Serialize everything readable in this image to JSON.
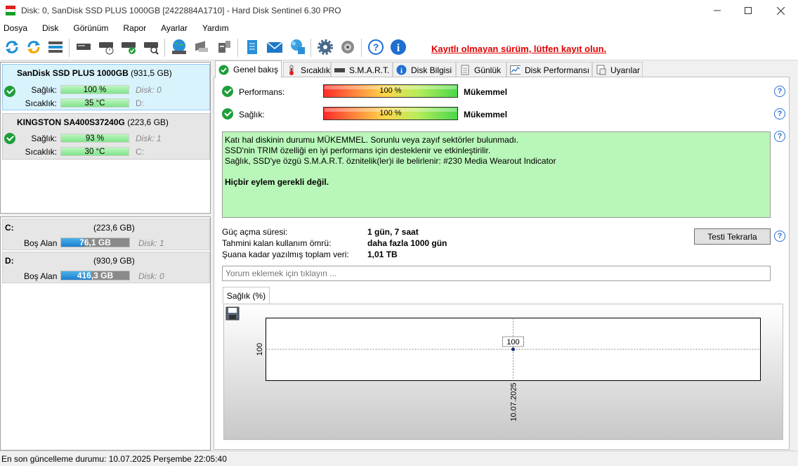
{
  "window": {
    "title": "Disk: 0, SanDisk SSD PLUS 1000GB [2422884A1710]  -  Hard Disk Sentinel 6.30 PRO"
  },
  "menu": [
    "Dosya",
    "Disk",
    "Görünüm",
    "Rapor",
    "Ayarlar",
    "Yardım"
  ],
  "toolbar": {
    "register_link": "Kayıtlı olmayan sürüm, lütfen kayıt olun.",
    "icons": [
      "refresh-icon",
      "refresh-all-icon",
      "disk-list-icon",
      "disk-info-icon",
      "disk-schedule-icon",
      "disk-check-icon",
      "disk-search-icon",
      "network-icon",
      "disk-surface-icon",
      "disk-backup-icon",
      "report-icon",
      "email-icon",
      "send-report-icon",
      "settings-icon",
      "sound-icon",
      "help-icon",
      "info-icon"
    ]
  },
  "disks": [
    {
      "name": "SanDisk SSD PLUS 1000GB",
      "size": "(931,5 GB)",
      "health_label": "Sağlık:",
      "health": "100 %",
      "health_frac": 1.0,
      "disk_no": "Disk: 0",
      "temp_label": "Sıcaklık:",
      "temp": "35 °C",
      "drive": "D:"
    },
    {
      "name": "KINGSTON SA400S37240G",
      "size": "(223,6 GB)",
      "health_label": "Sağlık:",
      "health": "93 %",
      "health_frac": 0.93,
      "disk_no": "Disk: 1",
      "temp_label": "Sıcaklık:",
      "temp": "30 °C",
      "drive": "C:"
    }
  ],
  "volumes": [
    {
      "letter": "C:",
      "size": "(223,6 GB)",
      "free_label": "Boş Alan",
      "free": "76,1 GB",
      "free_frac": 0.34,
      "disk": "Disk: 1"
    },
    {
      "letter": "D:",
      "size": "(930,9 GB)",
      "free_label": "Boş Alan",
      "free": "416,3 GB",
      "free_frac": 0.447,
      "disk": "Disk: 0"
    }
  ],
  "tabs": [
    "Genel bakış",
    "Sıcaklık",
    "S.M.A.R.T.",
    "Disk Bilgisi",
    "Günlük",
    "Disk Performansı",
    "Uyarılar"
  ],
  "overview": {
    "performance_label": "Performans:",
    "performance_value": "100 %",
    "performance_rating": "Mükemmel",
    "health_label": "Sağlık:",
    "health_value": "100 %",
    "health_rating": "Mükemmel",
    "status_lines": [
      "Katı hal diskinin durumu MÜKEMMEL. Sorunlu veya zayıf sektörler bulunmadı.",
      "SSD'nin TRIM özelliği en iyi performans için desteklenir ve etkinleştirilir.",
      "Sağlık, SSD'ye özgü S.M.A.R.T. öznitelik(ler)i ile belirlenir:  #230 Media Wearout Indicator"
    ],
    "status_action": "Hiçbir eylem gerekli değil.",
    "power_on_label": "Güç açma süresi:",
    "power_on_value": "1 gün, 7 saat",
    "lifetime_label": "Tahmini kalan kullanım ömrü:",
    "lifetime_value": "daha fazla 1000 gün",
    "written_label": "Şuana kadar yazılmış toplam veri:",
    "written_value": "1,01 TB",
    "retest_button": "Testi Tekrarla",
    "comment_placeholder": "Yorum eklemek için tıklayın ..."
  },
  "chart_tab": "Sağlık (%)",
  "chart_data": {
    "type": "line",
    "x": [
      "10.07.2025"
    ],
    "series": [
      {
        "values": [
          100
        ]
      }
    ],
    "data_labels": [
      "100"
    ],
    "y_tick_labels": [
      "100"
    ],
    "grid": true
  },
  "statusbar": {
    "text": "En son güncelleme durumu: 10.07.2025 Perşembe 22:05:40"
  }
}
